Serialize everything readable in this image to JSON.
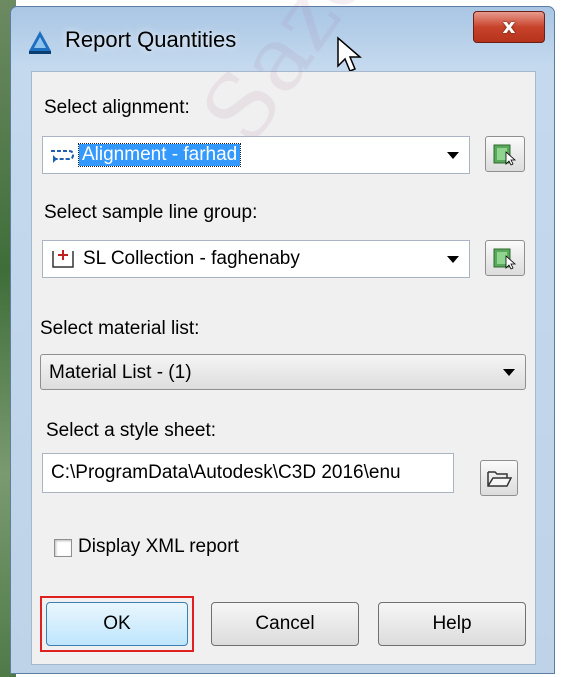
{
  "window": {
    "title": "Report Quantities",
    "close_label": "x"
  },
  "alignment": {
    "label": "Select alignment:",
    "value": "Alignment - farhad"
  },
  "sample_line_group": {
    "label": "Select sample line group:",
    "value": "SL Collection - faghenaby"
  },
  "material_list": {
    "label": "Select material list:",
    "value": "Material List - (1)"
  },
  "style_sheet": {
    "label": "Select a style sheet:",
    "value": "C:\\ProgramData\\Autodesk\\C3D 2016\\enu"
  },
  "display_xml": {
    "label": "Display XML report",
    "checked": false
  },
  "buttons": {
    "ok": "OK",
    "cancel": "Cancel",
    "help": "Help"
  },
  "colors": {
    "selection": "#3399ff",
    "highlight_border": "#e02020",
    "close_button": "#c8432b"
  }
}
